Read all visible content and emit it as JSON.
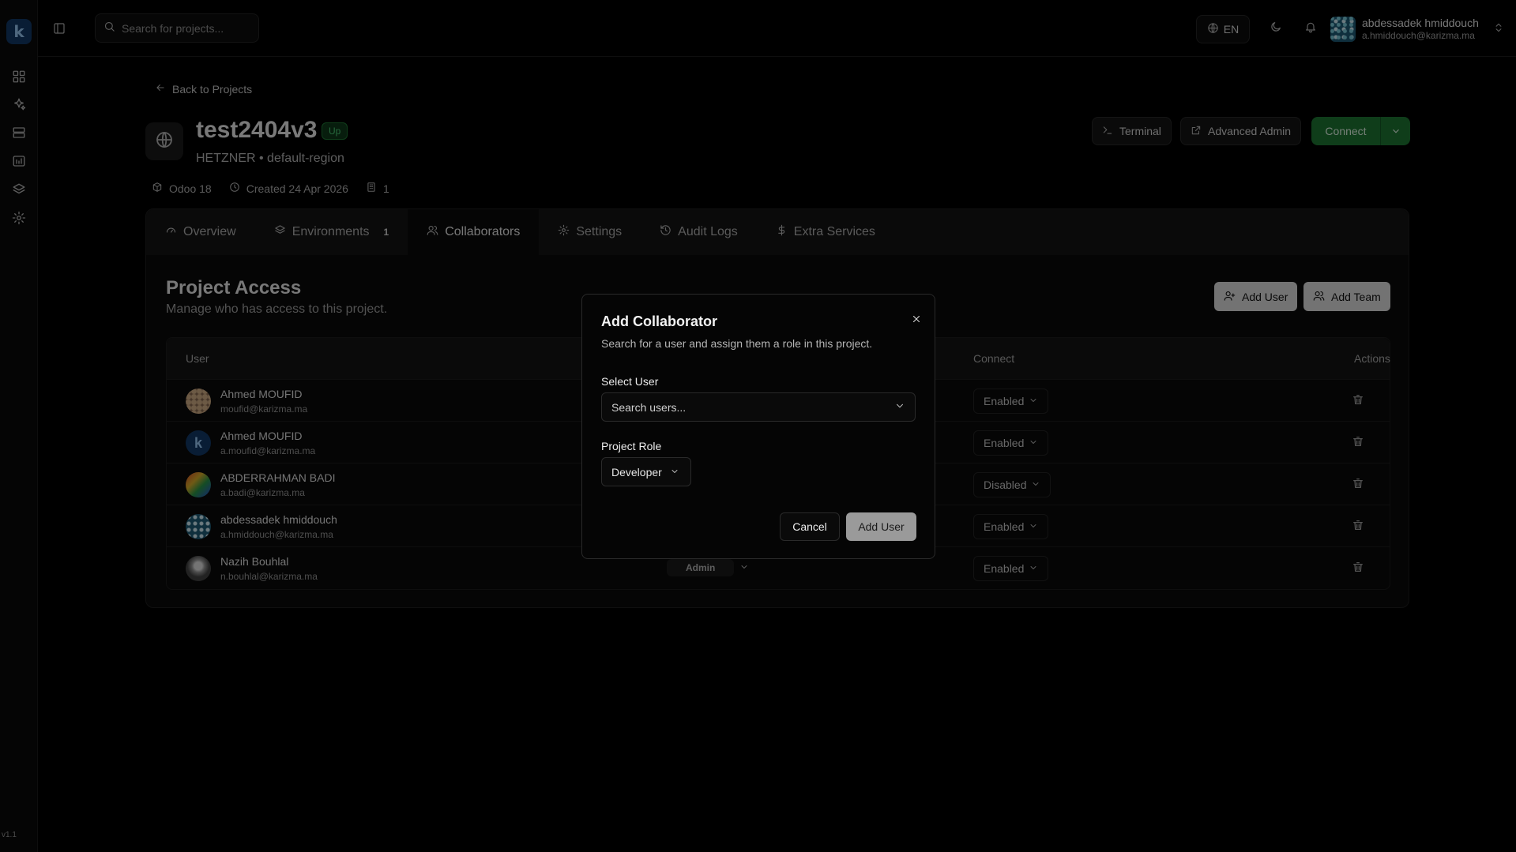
{
  "app": {
    "version": "v1.1"
  },
  "topbar": {
    "search_placeholder": "Search for projects...",
    "language": "EN",
    "user": {
      "name": "abdessadek hmiddouch",
      "email": "a.hmiddouch@karizma.ma"
    }
  },
  "project": {
    "back_label": "Back to Projects",
    "name": "test2404v3",
    "status": "Up",
    "subtitle": "HETZNER • default-region",
    "meta": {
      "version": "Odoo 18",
      "created": "Created 24 Apr 2026",
      "count": "1"
    },
    "actions": {
      "terminal": "Terminal",
      "advanced_admin": "Advanced Admin",
      "connect": "Connect"
    }
  },
  "tabs": [
    {
      "label": "Overview"
    },
    {
      "label": "Environments",
      "count": "1"
    },
    {
      "label": "Collaborators"
    },
    {
      "label": "Settings"
    },
    {
      "label": "Audit Logs"
    },
    {
      "label": "Extra Services"
    }
  ],
  "access": {
    "title": "Project Access",
    "subtitle": "Manage who has access to this project.",
    "add_user": "Add User",
    "add_team": "Add Team",
    "columns": {
      "user": "User",
      "connect": "Connect",
      "actions": "Actions"
    },
    "rows": [
      {
        "name": "Ahmed MOUFID",
        "email": "moufid@karizma.ma",
        "connect": "Enabled"
      },
      {
        "name": "Ahmed MOUFID",
        "email": "a.moufid@karizma.ma",
        "connect": "Enabled"
      },
      {
        "name": "ABDERRAHMAN BADI",
        "email": "a.badi@karizma.ma",
        "connect": "Disabled"
      },
      {
        "name": "abdessadek hmiddouch",
        "email": "a.hmiddouch@karizma.ma",
        "connect": "Enabled"
      },
      {
        "name": "Nazih Bouhlal",
        "email": "n.bouhlal@karizma.ma",
        "role": "Admin",
        "connect": "Enabled"
      }
    ]
  },
  "dialog": {
    "title": "Add Collaborator",
    "description": "Search for a user and assign them a role in this project.",
    "select_user_label": "Select User",
    "select_user_placeholder": "Search users...",
    "role_label": "Project Role",
    "role_value": "Developer",
    "cancel": "Cancel",
    "submit": "Add User"
  }
}
